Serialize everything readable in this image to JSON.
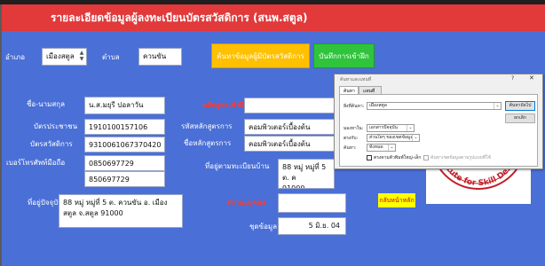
{
  "title": "รายละเอียดข้อมูลผู้ลงทะเบียนบัตรสวัสดิการ (สนพ.สตูล)",
  "filters": {
    "district_label": "อำเภอ",
    "district_value": "เมืองสตูล",
    "subdistrict_label": "ตำบล",
    "subdistrict_value": "ควนขัน"
  },
  "buttons": {
    "search_courses": "ค้นหาข้อมูลผู้มีบัตรสวัสดิการ",
    "save_training": "บันทึกการเข้าฝึก",
    "back_home": "กลับหน้าหลัก"
  },
  "person": {
    "name_label": "ชื่อ-นามสกุล",
    "name_value": "น.ส.มยุรี  ปอลาวัน",
    "id_label": "บัตรประชาชน",
    "id_value": "1910100157106",
    "welfare_label": "บัตรสวัสดิการ",
    "welfare_value": "9310061067370420",
    "phone_label": "เบอร์โทรศัพท์มือถือ",
    "phone_value": "0850697729",
    "phone2_value": "850697729",
    "address_label": "ที่อยู่ปัจจุบัน",
    "address_value": "88 หมู่ หมู่ที่ 5 ต. ควนขัน อ. เมืองสตูล จ.สตูล  91000"
  },
  "course": {
    "course_heading": "หลักสูตรเข้าฝึก",
    "course_code_label": "รหัสหลักสูตรการ",
    "course_code_value": "คอมพิวเตอร์เบื้องต้น",
    "course_name_label": "ชื่อหลักสูตรการ",
    "course_name_value": "คอมพิวเตอร์เบื้องต้น",
    "reg_address_label": "ที่อยู่ตามทะเบียนบ้าน",
    "reg_address_value": "88 หมู่ หมู่ที่ 5 ต. ค",
    "reg_address_zip": "91000",
    "train_place_label": "สถานะบุคคล",
    "date_label": "ชุดข้อมูล",
    "date_value": "5 มิ.ย. 04"
  },
  "dialog": {
    "title": "ค้นหาและแทนที่",
    "help_glyph": "?",
    "close_glyph": "✕",
    "tab_find": "ค้นหา",
    "tab_replace": "แทนที่",
    "find_what_label": "สิ่งที่ค้นหา:",
    "find_what_value": "เมืองสตูล",
    "find_next": "ค้นหาถัดไป",
    "cancel": "ยกเลิก",
    "look_in_label": "มองหาใน:",
    "look_in_value": "เอกสารปัจจุบัน",
    "search_label": "ค้นหา:",
    "search_value": "ทั้งหมด",
    "match_label": "ตรงกับ:",
    "match_value": "ส่วนใดๆ ของเขตข้อมูล",
    "match_case": "ตรงตามตัวพิมพ์ใหญ่-เล็ก",
    "search_formatted": "ค้นหาเขตข้อมูลตามรูปแบบที่ใช้"
  },
  "logo": {
    "arc_text": "Institute for Skill Dev"
  },
  "colors": {
    "title_bar": "#e2393a",
    "form_bg": "#4a6fd6",
    "search_button": "#ffc000",
    "save_button": "#2fc43b",
    "back_button": "#ffff00",
    "red_heading": "#ff3b30"
  }
}
